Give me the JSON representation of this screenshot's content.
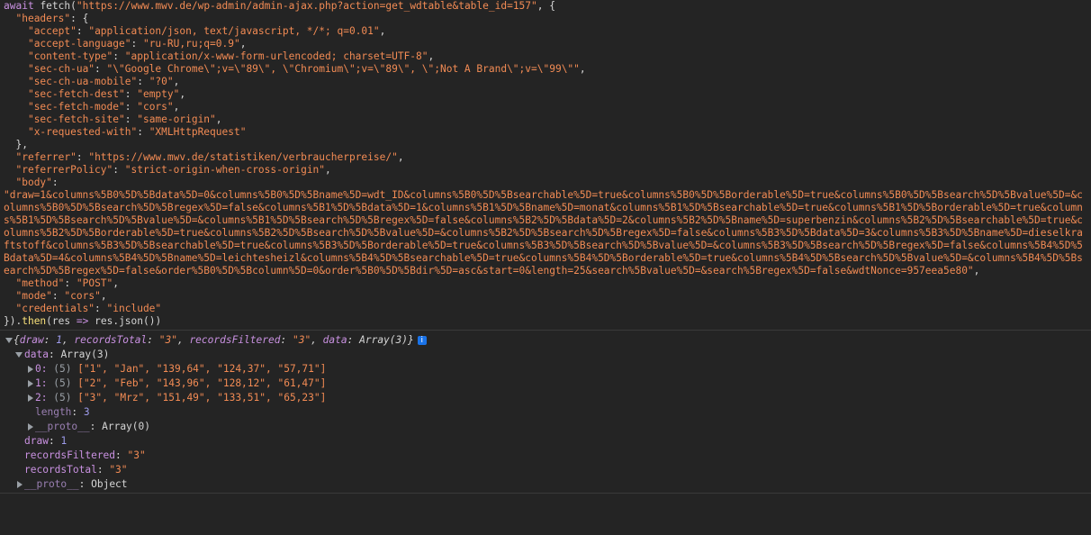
{
  "colors": {
    "background": "#242424",
    "string": "#f28b54",
    "keyword": "#c991e1",
    "function": "#f9e17a",
    "number": "#9d9bea",
    "text": "#d5d5d5",
    "badge": "#1a73e8"
  },
  "command": {
    "await_kw": "await",
    "fetch_fn": "fetch",
    "url": "\"https://www.mwv.de/wp-admin/admin-ajax.php?action=get_wdtable&table_id=157\"",
    "headers_key": "\"headers\"",
    "headers": [
      {
        "key": "\"accept\"",
        "value": "\"application/json, text/javascript, */*; q=0.01\""
      },
      {
        "key": "\"accept-language\"",
        "value": "\"ru-RU,ru;q=0.9\""
      },
      {
        "key": "\"content-type\"",
        "value": "\"application/x-www-form-urlencoded; charset=UTF-8\""
      },
      {
        "key": "\"sec-ch-ua\"",
        "value": "\"\\\"Google Chrome\\\";v=\\\"89\\\", \\\"Chromium\\\";v=\\\"89\\\", \\\";Not A Brand\\\";v=\\\"99\\\"\""
      },
      {
        "key": "\"sec-ch-ua-mobile\"",
        "value": "\"?0\""
      },
      {
        "key": "\"sec-fetch-dest\"",
        "value": "\"empty\""
      },
      {
        "key": "\"sec-fetch-mode\"",
        "value": "\"cors\""
      },
      {
        "key": "\"sec-fetch-site\"",
        "value": "\"same-origin\""
      },
      {
        "key": "\"x-requested-with\"",
        "value": "\"XMLHttpRequest\""
      }
    ],
    "referrer_key": "\"referrer\"",
    "referrer": "\"https://www.mwv.de/statistiken/verbraucherpreise/\"",
    "referrerPolicy_key": "\"referrerPolicy\"",
    "referrerPolicy": "\"strict-origin-when-cross-origin\"",
    "body_key": "\"body\"",
    "body": "\"draw=1&columns%5B0%5D%5Bdata%5D=0&columns%5B0%5D%5Bname%5D=wdt_ID&columns%5B0%5D%5Bsearchable%5D=true&columns%5B0%5D%5Borderable%5D=true&columns%5B0%5D%5Bsearch%5D%5Bvalue%5D=&columns%5B0%5D%5Bsearch%5D%5Bregex%5D=false&columns%5B1%5D%5Bdata%5D=1&columns%5B1%5D%5Bname%5D=monat&columns%5B1%5D%5Bsearchable%5D=true&columns%5B1%5D%5Borderable%5D=true&columns%5B1%5D%5Bsearch%5D%5Bvalue%5D=&columns%5B1%5D%5Bsearch%5D%5Bregex%5D=false&columns%5B2%5D%5Bdata%5D=2&columns%5B2%5D%5Bname%5D=superbenzin&columns%5B2%5D%5Bsearchable%5D=true&columns%5B2%5D%5Borderable%5D=true&columns%5B2%5D%5Bsearch%5D%5Bvalue%5D=&columns%5B2%5D%5Bsearch%5D%5Bregex%5D=false&columns%5B3%5D%5Bdata%5D=3&columns%5B3%5D%5Bname%5D=dieselkraftstoff&columns%5B3%5D%5Bsearchable%5D=true&columns%5B3%5D%5Borderable%5D=true&columns%5B3%5D%5Bsearch%5D%5Bvalue%5D=&columns%5B3%5D%5Bsearch%5D%5Bregex%5D=false&columns%5B4%5D%5Bdata%5D=4&columns%5B4%5D%5Bname%5D=leichtesheizl&columns%5B4%5D%5Bsearchable%5D=true&columns%5B4%5D%5Borderable%5D=true&columns%5B4%5D%5Bsearch%5D%5Bvalue%5D=&columns%5B4%5D%5Bsearch%5D%5Bregex%5D=false&order%5B0%5D%5Bcolumn%5D=0&order%5B0%5D%5Bdir%5D=asc&start=0&length=25&search%5Bvalue%5D=&search%5Bregex%5D=false&wdtNonce=957eea5e80\"",
    "method_key": "\"method\"",
    "method": "\"POST\"",
    "mode_key": "\"mode\"",
    "mode": "\"cors\"",
    "credentials_key": "\"credentials\"",
    "credentials": "\"include\"",
    "then_fn": "then",
    "res_param": "res",
    "arrow": "=>",
    "res_json": "res.json"
  },
  "output": {
    "summary": {
      "draw_key": "draw",
      "draw_val": "1",
      "recordsTotal_key": "recordsTotal",
      "recordsTotal_val": "\"3\"",
      "recordsFiltered_key": "recordsFiltered",
      "recordsFiltered_val": "\"3\"",
      "data_key": "data",
      "data_val": "Array(3)",
      "info_glyph": "i"
    },
    "data_key": "data",
    "data_type": "Array(3)",
    "rows": [
      {
        "index": "0:",
        "len": "(5)",
        "values": "[\"1\", \"Jan\", \"139,64\", \"124,37\", \"57,71\"]"
      },
      {
        "index": "1:",
        "len": "(5)",
        "values": "[\"2\", \"Feb\", \"143,96\", \"128,12\", \"61,47\"]"
      },
      {
        "index": "2:",
        "len": "(5)",
        "values": "[\"3\", \"Mrz\", \"151,49\", \"133,51\", \"65,23\"]"
      }
    ],
    "length_key": "length",
    "length_val": "3",
    "proto_key": "__proto__",
    "proto_array": "Array(0)",
    "draw_key": "draw",
    "draw_val": "1",
    "recordsFiltered_key": "recordsFiltered",
    "recordsFiltered_val": "\"3\"",
    "recordsTotal_key": "recordsTotal",
    "recordsTotal_val": "\"3\"",
    "proto_object": "Object"
  }
}
